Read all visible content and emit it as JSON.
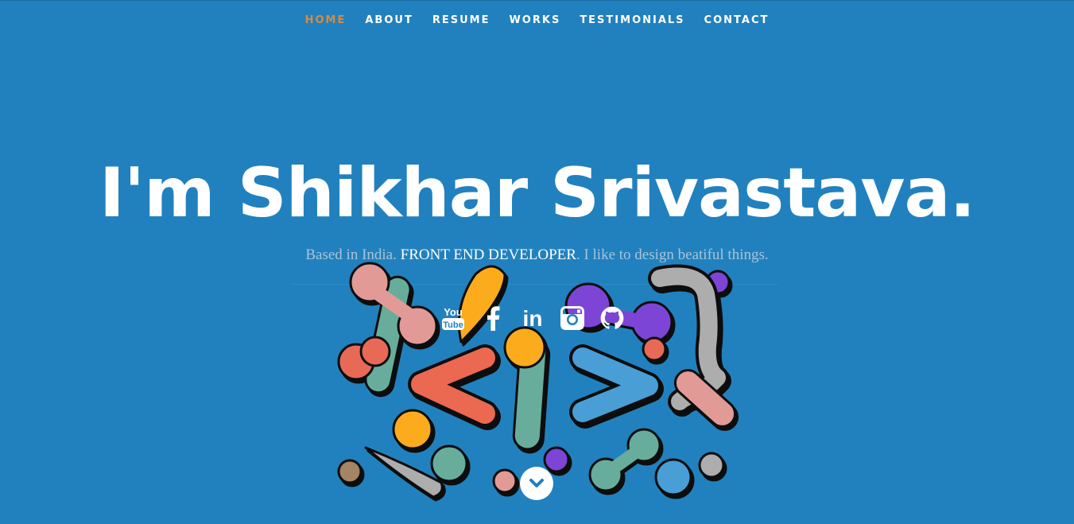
{
  "nav": {
    "items": [
      {
        "label": "HOME",
        "active": true
      },
      {
        "label": "ABOUT"
      },
      {
        "label": "RESUME"
      },
      {
        "label": "WORKS"
      },
      {
        "label": "TESTIMONIALS"
      },
      {
        "label": "CONTACT"
      }
    ]
  },
  "hero": {
    "title": "I'm Shikhar Srivastava.",
    "intro": "Based in India.",
    "role": "FRONT END DEVELOPER",
    "tagline": ". I like to design beatiful things."
  },
  "social": {
    "icons": [
      "youtube-icon",
      "facebook-icon",
      "linkedin-icon",
      "instagram-icon",
      "github-icon"
    ],
    "youtube_you": "You",
    "youtube_tube": "Tube",
    "linkedin_text": "in"
  },
  "colors": {
    "background": "#2181be",
    "nav_active": "#d98a3d",
    "text": "#ffffff",
    "subtext": "#a9c3d6"
  }
}
